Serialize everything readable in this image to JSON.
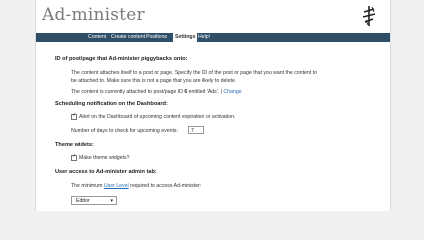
{
  "app": {
    "title": "Ad-minister"
  },
  "nav": {
    "items": [
      {
        "label": "Content"
      },
      {
        "label": "Create content"
      },
      {
        "label": "Positions"
      },
      {
        "label": "Settings"
      },
      {
        "label": "Help!"
      }
    ],
    "active": "Settings"
  },
  "settings": {
    "piggyback": {
      "heading": "ID of post/page that Ad-minister piggybacks onto:",
      "desc_line1": "The content attaches itself to a post or page. Specify the ID of the post or page that you want the content to",
      "desc_line2": "be attached to. Make sure this is not a page that you are likely to delete.",
      "current_prefix": "The content is currently attached to post/page ID ",
      "current_id": "6",
      "current_mid": " entitled 'Ads'. | ",
      "change_link": "Change"
    },
    "scheduling": {
      "heading": "Scheduling notification on the Dashboard:",
      "alert_label": "Alert on the Dashboard of upcoming content expiration or activation.",
      "days_label": "Number of days to check for upcoming events:",
      "days_value": "7"
    },
    "theme": {
      "heading": "Theme widets:",
      "widgets_label": "Make theme widgets?"
    },
    "access": {
      "heading": "User access to Ad-minister admin tab:",
      "level_prefix": "The minimum ",
      "level_link": "User Level",
      "level_suffix": " required to access Ad-minister:",
      "level_value": "Editor"
    }
  }
}
